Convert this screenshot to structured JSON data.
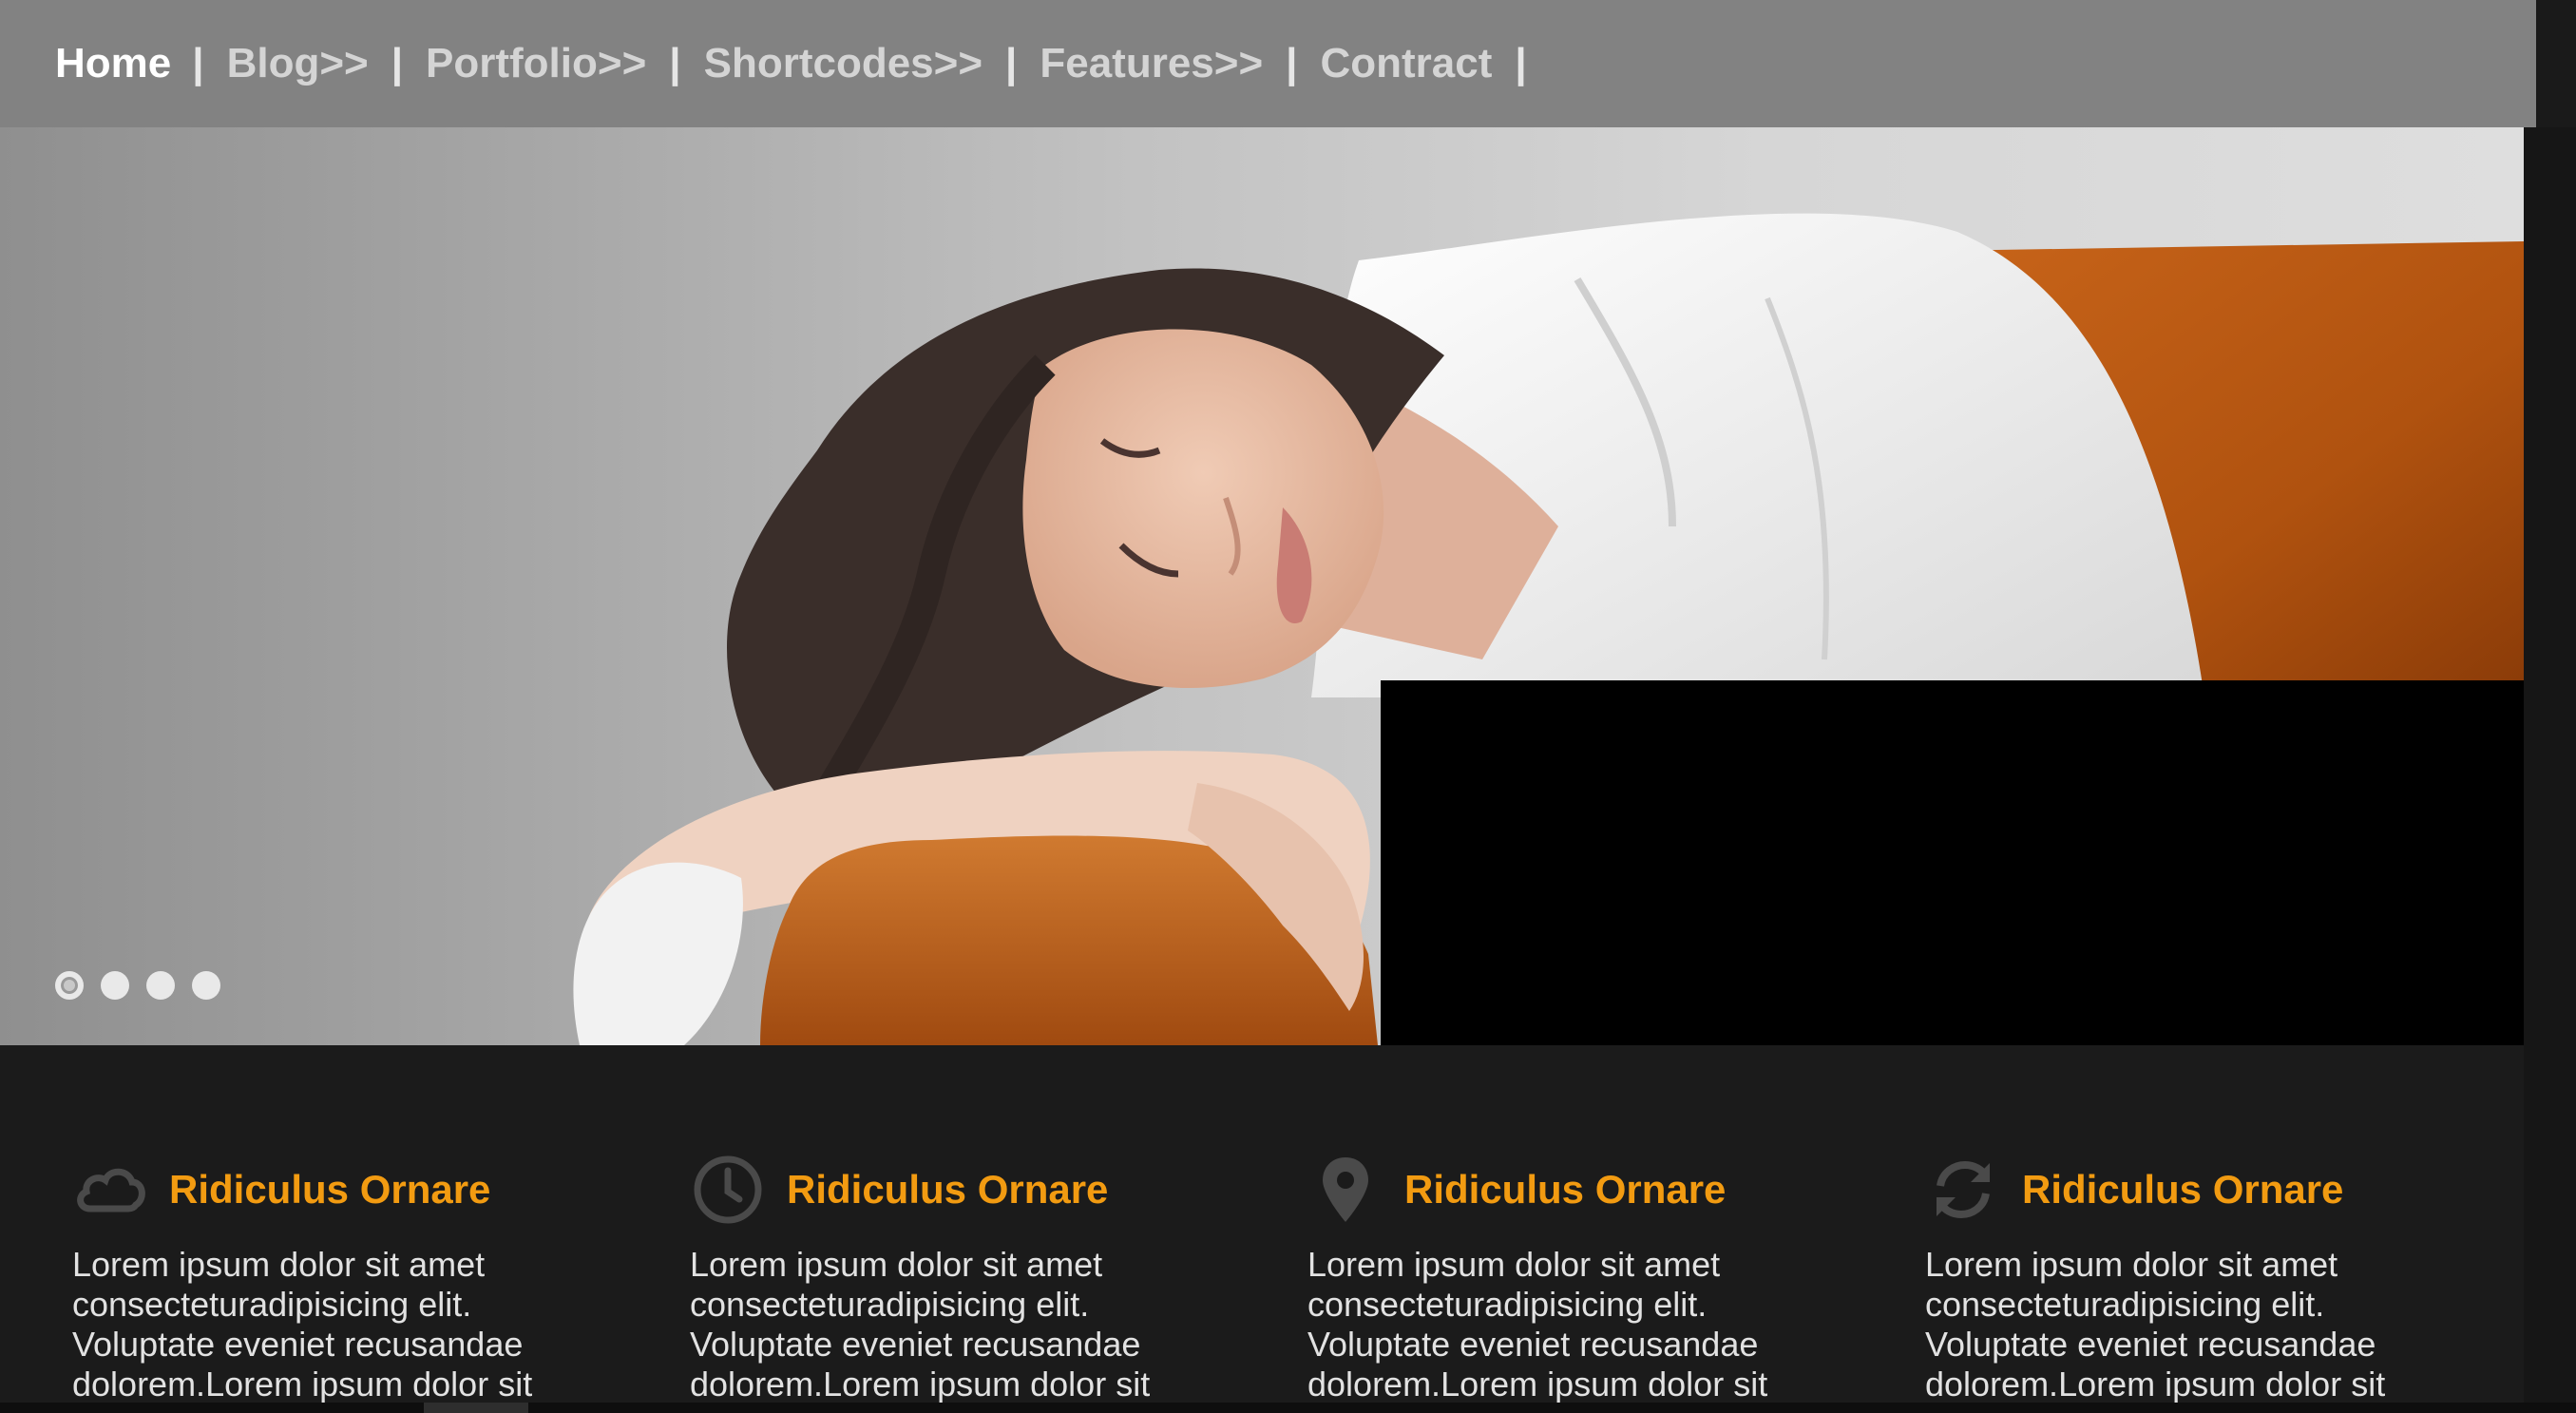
{
  "nav": {
    "items": [
      {
        "label": "Home",
        "active": true
      },
      {
        "label": "Blog>>",
        "active": false
      },
      {
        "label": "Portfolio>>",
        "active": false
      },
      {
        "label": "Shortcodes>>",
        "active": false
      },
      {
        "label": "Features>>",
        "active": false
      },
      {
        "label": "Contract",
        "active": false
      }
    ],
    "separator": "|"
  },
  "slider": {
    "slide_count": 4,
    "active_slide": 1
  },
  "features": [
    {
      "icon": "cloud-icon",
      "title": "Ridiculus Ornare",
      "text": "Lorem ipsum dolor sit amet consecteturadipisicing elit. Voluptate eveniet recusandae dolorem.Lorem ipsum dolor sit"
    },
    {
      "icon": "clock-icon",
      "title": "Ridiculus Ornare",
      "text": "Lorem ipsum dolor sit amet consecteturadipisicing elit. Voluptate eveniet recusandae dolorem.Lorem ipsum dolor sit"
    },
    {
      "icon": "map-pin-icon",
      "title": "Ridiculus Ornare",
      "text": "Lorem ipsum dolor sit amet consecteturadipisicing elit. Voluptate eveniet recusandae dolorem.Lorem ipsum dolor sit"
    },
    {
      "icon": "refresh-icon",
      "title": "Ridiculus Ornare",
      "text": "Lorem ipsum dolor sit amet consecteturadipisicing elit. Voluptate eveniet recusandae dolorem.Lorem ipsum dolor sit"
    }
  ],
  "colors": {
    "nav_bg": "#828282",
    "accent": "#f29b11",
    "page_bg": "#1b1b1b"
  }
}
